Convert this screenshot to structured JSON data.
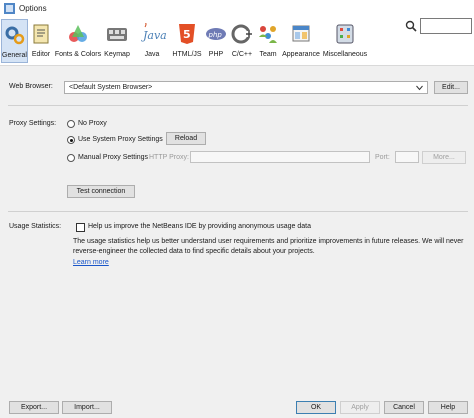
{
  "window": {
    "title": "Options"
  },
  "toolbar": {
    "categories": [
      {
        "label": "General",
        "icon": "gear-icon",
        "selected": true
      },
      {
        "label": "Editor",
        "icon": "editor-icon"
      },
      {
        "label": "Fonts & Colors",
        "icon": "fonts-colors-icon"
      },
      {
        "label": "Keymap",
        "icon": "keymap-icon"
      },
      {
        "label": "Java",
        "icon": "java-icon"
      },
      {
        "label": "HTML/JS",
        "icon": "html5-icon"
      },
      {
        "label": "PHP",
        "icon": "php-icon"
      },
      {
        "label": "C/C++",
        "icon": "cpp-icon"
      },
      {
        "label": "Team",
        "icon": "team-icon"
      },
      {
        "label": "Appearance",
        "icon": "appearance-icon"
      },
      {
        "label": "Miscellaneous",
        "icon": "miscellaneous-icon"
      }
    ],
    "java_glyph": "Java",
    "html5_glyph": "5",
    "php_glyph": "php"
  },
  "search": {
    "value": ""
  },
  "general": {
    "web_browser_label": "Web Browser:",
    "web_browser_value": "<Default System Browser>",
    "edit_button": "Edit...",
    "proxy_label": "Proxy Settings:",
    "no_proxy": "No Proxy",
    "use_system_proxy": "Use System Proxy Settings",
    "reload_button": "Reload",
    "manual_proxy": "Manual Proxy Settings",
    "http_proxy_label": "HTTP Proxy:",
    "port_label": "Port:",
    "more_button": "More...",
    "test_connection_button": "Test connection",
    "usage_label": "Usage Statistics:",
    "usage_checkbox": "Help us improve the NetBeans IDE by providing anonymous usage data",
    "usage_description": "The usage statistics help us better understand user requirements and prioritize improvements in future releases. We will never reverse-engineer the collected data to find specific details about your projects.",
    "learn_more": "Learn more"
  },
  "footer": {
    "export_button": "Export...",
    "import_button": "Import...",
    "ok_button": "OK",
    "apply_button": "Apply",
    "cancel_button": "Cancel",
    "help_button": "Help"
  }
}
